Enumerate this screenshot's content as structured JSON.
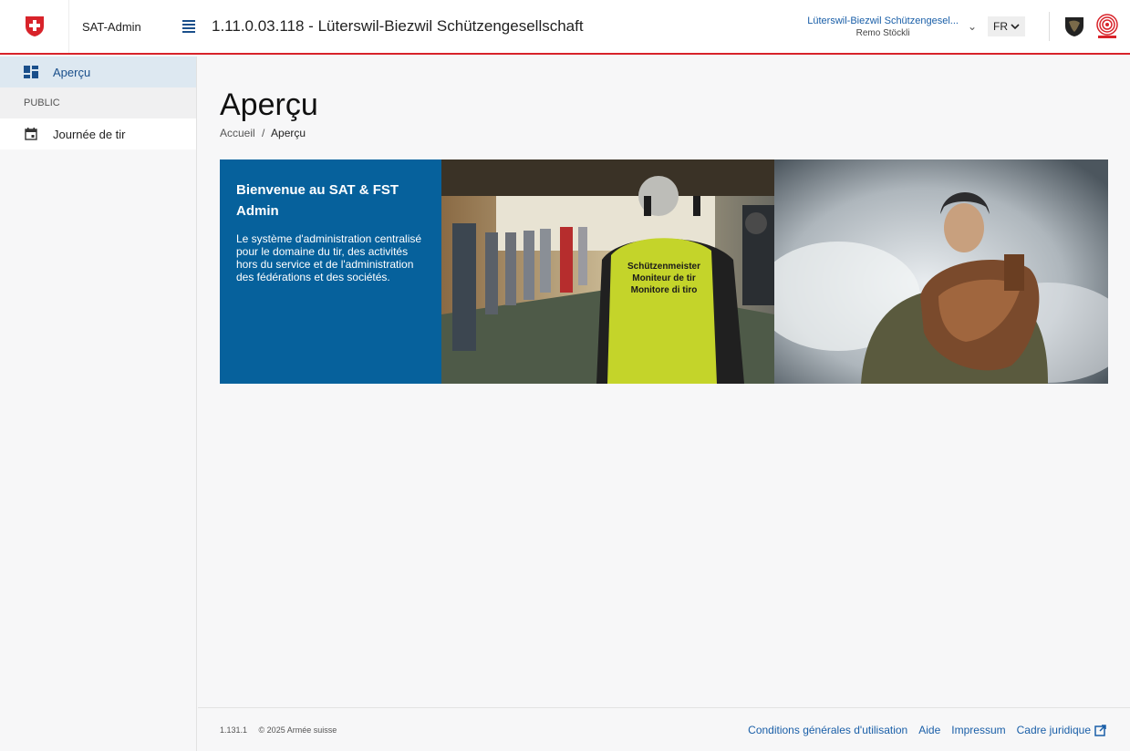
{
  "header": {
    "app_name": "SAT-Admin",
    "page_heading": "1.11.0.03.118 - Lüterswil-Biezwil Schützengesellschaft",
    "org_name": "Lüterswil-Biezwil Schützengesel...",
    "user_name": "Remo Stöckli",
    "language": "FR",
    "icons": [
      "swiss-cross-icon",
      "menu-icon",
      "chevron-down-icon",
      "army-shield-icon",
      "target-icon"
    ]
  },
  "sidebar": {
    "items": [
      {
        "label": "Aperçu",
        "icon": "dashboard-icon",
        "active": true
      },
      {
        "label": "PUBLIC",
        "section": true
      },
      {
        "label": "Journée de tir",
        "icon": "calendar-icon",
        "active": false
      }
    ]
  },
  "main": {
    "title": "Aperçu",
    "breadcrumb": {
      "home": "Accueil",
      "separator": "/",
      "current": "Aperçu"
    },
    "hero": {
      "title": "Bienvenue au SAT & FST Admin",
      "body": "Le système d'administration centralisé pour le domaine du tir, des activités hors du service et de l'administration des fédérations et des sociétés.",
      "vest_text": [
        "Schützenmeister",
        "Moniteur de tir",
        "Monitore di tiro"
      ]
    }
  },
  "footer": {
    "version": "1.131.1",
    "copyright": "© 2025 Armée suisse",
    "links": [
      "Conditions générales d'utilisation",
      "Aide",
      "Impressum",
      "Cadre juridique"
    ]
  },
  "colors": {
    "brand_red": "#d8232a",
    "hero_blue": "#06619c",
    "link_blue": "#1a5fa8"
  }
}
